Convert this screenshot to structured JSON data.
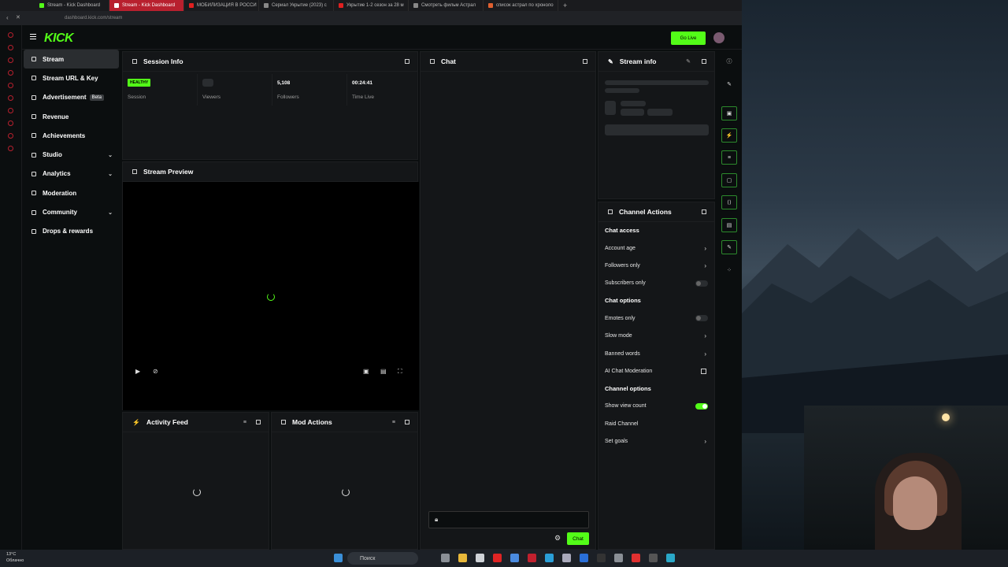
{
  "browser": {
    "tabs": [
      {
        "label": "Stream - Kick Dashboard",
        "color": "#53fc18"
      },
      {
        "label": "Stream - Kick Dashboard",
        "color": "#ffffff"
      },
      {
        "label": "МОБИЛИЗАЦИЯ В РОССИ",
        "color": "#e02020"
      },
      {
        "label": "Сериал Укрытие (2023) с",
        "color": "#888888"
      },
      {
        "label": "Укрытие 1-2 сезон за 28 м",
        "color": "#e02020"
      },
      {
        "label": "Смотреть фильм Астрал",
        "color": "#888888"
      },
      {
        "label": "список астрал по хроноло",
        "color": "#e06030"
      }
    ],
    "url": "dashboard.kick.com/stream"
  },
  "header": {
    "logo": "KICK",
    "go_live": "Go Live"
  },
  "sidebar": {
    "items": [
      {
        "label": "Stream",
        "active": true
      },
      {
        "label": "Stream URL & Key"
      },
      {
        "label": "Advertisement",
        "badge": "Beta"
      },
      {
        "label": "Revenue"
      },
      {
        "label": "Achievements"
      },
      {
        "label": "Studio",
        "expandable": true
      },
      {
        "label": "Analytics",
        "expandable": true
      },
      {
        "label": "Moderation"
      },
      {
        "label": "Community",
        "expandable": true
      },
      {
        "label": "Drops & rewards"
      }
    ]
  },
  "session": {
    "title": "Session Info",
    "health": "HEALTHY",
    "session_label": "Session",
    "viewers_label": "Viewers",
    "followers_value": "5,108",
    "followers_label": "Followers",
    "time_value": "00:24:41",
    "time_label": "Time Live"
  },
  "preview": {
    "title": "Stream Preview"
  },
  "activity": {
    "title": "Activity Feed"
  },
  "mod": {
    "title": "Mod Actions"
  },
  "chat": {
    "title": "Chat",
    "send_label": "Chat"
  },
  "stream_info": {
    "title": "Stream info"
  },
  "channel_actions": {
    "title": "Channel Actions",
    "chat_access_title": "Chat access",
    "account_age": "Account age",
    "followers_only": "Followers only",
    "subscribers_only": "Subscribers only",
    "chat_options_title": "Chat options",
    "emotes_only": "Emotes only",
    "slow_mode": "Slow mode",
    "banned_words": "Banned words",
    "ai_moderation": "AI Chat Moderation",
    "channel_options_title": "Channel options",
    "show_view_count": "Show view count",
    "show_view_count_on": true,
    "raid_channel": "Raid Channel",
    "set_goals": "Set goals"
  },
  "taskbar": {
    "temp": "13°C",
    "weather": "Облачно",
    "search": "Поиск"
  },
  "colors": {
    "accent": "#53fc18",
    "panel": "#141618",
    "background": "#0b0e0f"
  }
}
